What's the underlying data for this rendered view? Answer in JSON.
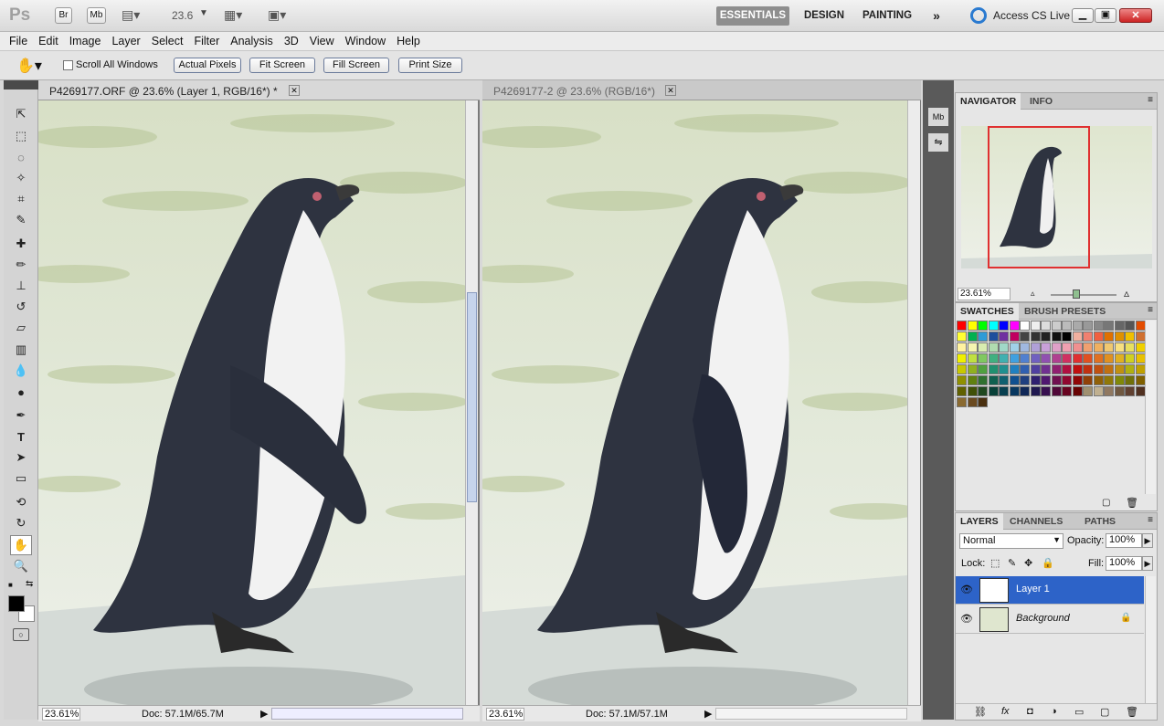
{
  "app": {
    "logo": "Ps",
    "br": "Br",
    "mb": "Mb",
    "zoom": "23.6",
    "access": "Access CS Live"
  },
  "workspaces": [
    "ESSENTIALS",
    "DESIGN",
    "PAINTING"
  ],
  "menu": [
    "File",
    "Edit",
    "Image",
    "Layer",
    "Select",
    "Filter",
    "Analysis",
    "3D",
    "View",
    "Window",
    "Help"
  ],
  "options": {
    "scroll_all": "Scroll All Windows",
    "actual": "Actual Pixels",
    "fit": "Fit Screen",
    "fill": "Fill Screen",
    "print": "Print Size"
  },
  "doc1": {
    "title": "P4269177.ORF @ 23.6% (Layer 1, RGB/16*) *",
    "zoom": "23.61%",
    "info": "Doc: 57.1M/65.7M"
  },
  "doc2": {
    "title": "P4269177-2 @ 23.6% (RGB/16*)",
    "zoom": "23.61%",
    "info": "Doc: 57.1M/57.1M"
  },
  "navigator": {
    "tabs": [
      "NAVIGATOR",
      "INFO"
    ],
    "zoom": "23.61%"
  },
  "swatches": {
    "tabs": [
      "SWATCHES",
      "BRUSH PRESETS"
    ]
  },
  "layers": {
    "tabs": [
      "LAYERS",
      "CHANNELS",
      "PATHS"
    ],
    "blend": "Normal",
    "opacity_label": "Opacity:",
    "opacity": "100%",
    "lock_label": "Lock:",
    "fill_label": "Fill:",
    "fill": "100%",
    "items": [
      "Layer 1",
      "Background"
    ]
  },
  "colors": {
    "accent": "#2d63c8",
    "swatch_rows": [
      [
        "#ff0000",
        "#ffff00",
        "#00ff00",
        "#00ffff",
        "#0000ff",
        "#ff00ff",
        "#ffffff",
        "#eeeeee",
        "#dddddd",
        "#cccccc",
        "#bbbbbb",
        "#aaaaaa",
        "#999999",
        "#888888",
        "#777777",
        "#666666",
        "#555555",
        "#e34c00"
      ],
      [
        "#ffff33",
        "#00b050",
        "#2e9bd6",
        "#1f4e9c",
        "#7030a0",
        "#c00060",
        "#444444",
        "#333333",
        "#222222",
        "#111111",
        "#000000",
        "#f0b0a0",
        "#f08070",
        "#f06040",
        "#e07000",
        "#e09000",
        "#f0c000",
        "#d07030"
      ],
      [
        "#fff2a0",
        "#f5f5b0",
        "#d9ecb0",
        "#b0dcb0",
        "#a0d8c8",
        "#a0d0e8",
        "#a0b8e0",
        "#b0a0d8",
        "#c8a0d8",
        "#e0a0c8",
        "#f0a0b0",
        "#f09090",
        "#f0a070",
        "#f0b060",
        "#f0c870",
        "#f8e080",
        "#e8e060",
        "#f0d000"
      ],
      [
        "#f0f000",
        "#c0e040",
        "#80c860",
        "#40b080",
        "#40b0b0",
        "#40a0e0",
        "#5080d0",
        "#7060c0",
        "#9050b0",
        "#b04090",
        "#d03060",
        "#e03030",
        "#e05020",
        "#e07020",
        "#e09020",
        "#e0b020",
        "#d0d020",
        "#e8c000"
      ],
      [
        "#c8c800",
        "#90b020",
        "#50a040",
        "#209070",
        "#209090",
        "#2080c0",
        "#3060b0",
        "#5040a0",
        "#703090",
        "#902070",
        "#b01040",
        "#c01010",
        "#c03010",
        "#c05010",
        "#c07010",
        "#c09010",
        "#b0b010",
        "#c0a000"
      ],
      [
        "#909000",
        "#608010",
        "#307030",
        "#106050",
        "#106070",
        "#105090",
        "#204080",
        "#302070",
        "#501870",
        "#701050",
        "#900830",
        "#900808",
        "#904008",
        "#906008",
        "#907808",
        "#808808",
        "#707008",
        "#806000"
      ],
      [
        "#606000",
        "#405008",
        "#204820",
        "#084038",
        "#084050",
        "#083860",
        "#102858",
        "#201850",
        "#381050",
        "#500838",
        "#680420",
        "#680404",
        "#a09070",
        "#c0b090",
        "#907860",
        "#705840",
        "#604030",
        "#503020"
      ],
      [
        "#8a6a30",
        "#6a4a20",
        "#4a3010"
      ]
    ]
  }
}
